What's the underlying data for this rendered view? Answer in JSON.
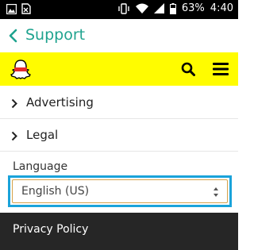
{
  "status_bar": {
    "battery": "63%",
    "time": "4:40",
    "icons": [
      "image-icon",
      "sim-icon",
      "vibrate-icon",
      "wifi-icon",
      "signal-icon",
      "battery-icon"
    ]
  },
  "app_bar": {
    "title": "Support",
    "back_icon": "chevron-left-icon",
    "accent_color": "#1fa38f"
  },
  "site_header": {
    "background": "#fffc00",
    "logo_icon": "snapchat-ghost-icon",
    "search_icon": "search-icon",
    "menu_icon": "hamburger-menu-icon"
  },
  "sections": [
    {
      "label": "Advertising"
    },
    {
      "label": "Legal"
    }
  ],
  "language": {
    "label": "Language",
    "selected": "English (US)",
    "highlight_color": "#1aa3da"
  },
  "footer": {
    "link": "Privacy Policy"
  }
}
